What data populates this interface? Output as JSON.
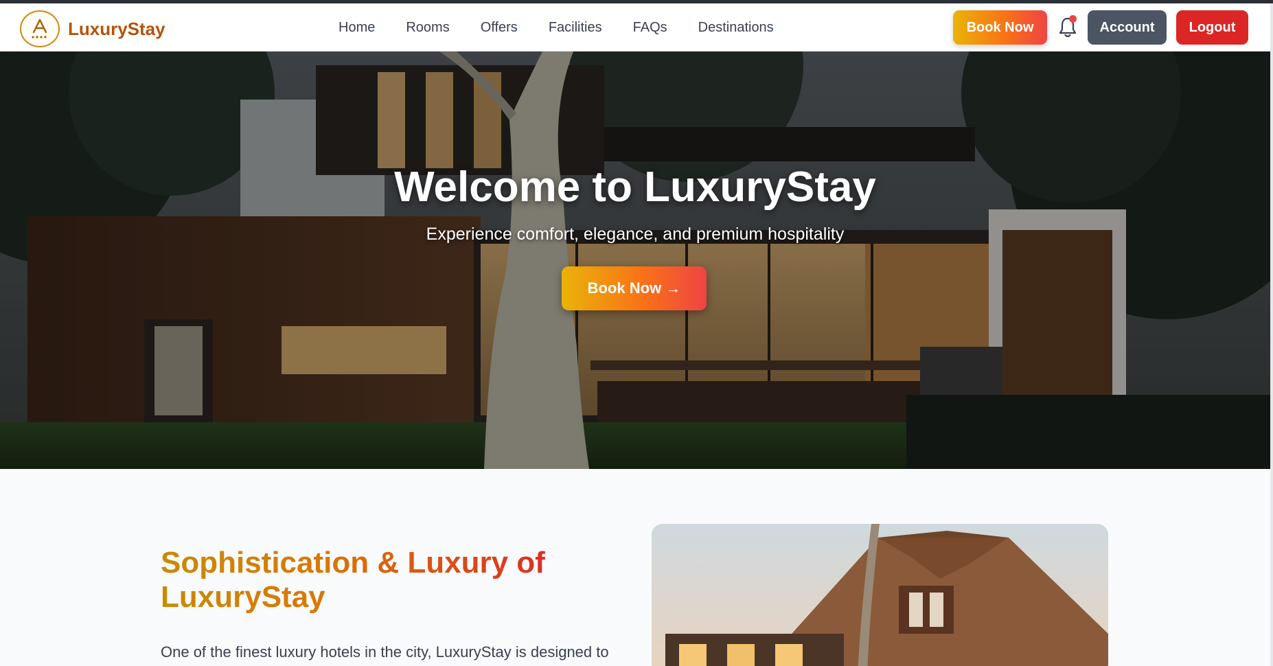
{
  "brand": {
    "name": "LuxuryStay",
    "logo_icon": "hotel-crest-logo",
    "color": "#b45309"
  },
  "nav": {
    "links": [
      "Home",
      "Rooms",
      "Offers",
      "Facilities",
      "FAQs",
      "Destinations"
    ],
    "book_label": "Book Now",
    "account_label": "Account",
    "logout_label": "Logout",
    "notification_icon": "bell-icon"
  },
  "hero": {
    "title": "Welcome to LuxuryStay",
    "subtitle": "Experience comfort, elegance, and premium hospitality",
    "cta_label": "Book Now →"
  },
  "about": {
    "title": "Sophistication & Luxury of LuxuryStay",
    "text": "One of the finest luxury hotels in the city, LuxuryStay is designed to"
  },
  "colors": {
    "accent_gradient": [
      "#eab308",
      "#f97316",
      "#ef4444"
    ],
    "account": "#4b5563",
    "logout": "#dc2626"
  }
}
